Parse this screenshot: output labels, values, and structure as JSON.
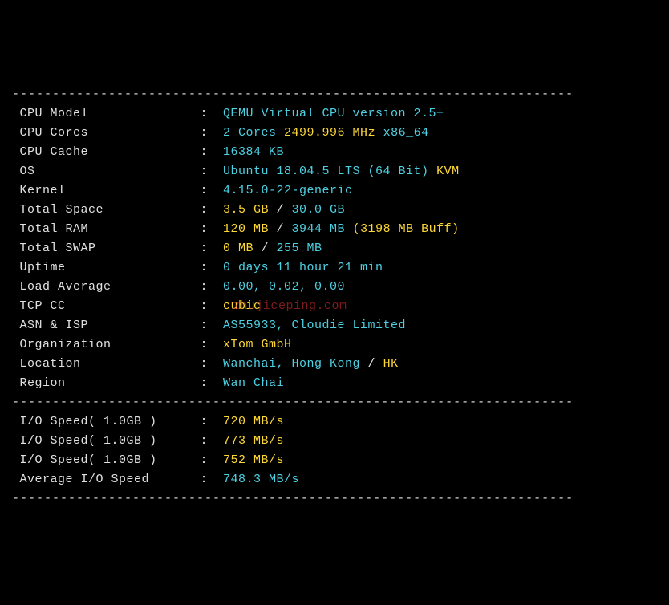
{
  "divider": "----------------------------------------------------------------------",
  "rows": [
    {
      "label": "CPU Model",
      "value": [
        {
          "c": "cyan",
          "t": "QEMU Virtual CPU version 2.5+"
        }
      ]
    },
    {
      "label": "CPU Cores",
      "value": [
        {
          "c": "cyan",
          "t": "2 Cores"
        },
        {
          "c": "white",
          "t": " "
        },
        {
          "c": "yellow",
          "t": "2499.996 MHz"
        },
        {
          "c": "white",
          "t": " "
        },
        {
          "c": "cyan",
          "t": "x86_64"
        }
      ]
    },
    {
      "label": "CPU Cache",
      "value": [
        {
          "c": "cyan",
          "t": "16384 KB"
        }
      ]
    },
    {
      "label": "OS",
      "value": [
        {
          "c": "cyan",
          "t": "Ubuntu 18.04.5 LTS (64 Bit)"
        },
        {
          "c": "white",
          "t": " "
        },
        {
          "c": "yellow",
          "t": "KVM"
        }
      ]
    },
    {
      "label": "Kernel",
      "value": [
        {
          "c": "cyan",
          "t": "4.15.0-22-generic"
        }
      ]
    },
    {
      "label": "Total Space",
      "value": [
        {
          "c": "yellow",
          "t": "3.5 GB"
        },
        {
          "c": "white",
          "t": " / "
        },
        {
          "c": "cyan",
          "t": "30.0 GB"
        }
      ]
    },
    {
      "label": "Total RAM",
      "value": [
        {
          "c": "yellow",
          "t": "120 MB"
        },
        {
          "c": "white",
          "t": " / "
        },
        {
          "c": "cyan",
          "t": "3944 MB"
        },
        {
          "c": "white",
          "t": " "
        },
        {
          "c": "yellow",
          "t": "(3198 MB Buff)"
        }
      ]
    },
    {
      "label": "Total SWAP",
      "value": [
        {
          "c": "yellow",
          "t": "0 MB"
        },
        {
          "c": "white",
          "t": " / "
        },
        {
          "c": "cyan",
          "t": "255 MB"
        }
      ]
    },
    {
      "label": "Uptime",
      "value": [
        {
          "c": "cyan",
          "t": "0 days 11 hour 21 min"
        }
      ]
    },
    {
      "label": "Load Average",
      "value": [
        {
          "c": "cyan",
          "t": "0.00, 0.02, 0.00"
        }
      ]
    },
    {
      "label": "TCP CC",
      "value": [
        {
          "c": "yellow",
          "t": "cubic"
        }
      ]
    },
    {
      "label": "ASN & ISP",
      "value": [
        {
          "c": "cyan",
          "t": "AS55933, Cloudie Limited"
        }
      ]
    },
    {
      "label": "Organization",
      "value": [
        {
          "c": "yellow",
          "t": "xTom GmbH"
        }
      ]
    },
    {
      "label": "Location",
      "value": [
        {
          "c": "cyan",
          "t": "Wanchai, Hong Kong"
        },
        {
          "c": "white",
          "t": " / "
        },
        {
          "c": "yellow",
          "t": "HK"
        }
      ]
    },
    {
      "label": "Region",
      "value": [
        {
          "c": "cyan",
          "t": "Wan Chai"
        }
      ]
    }
  ],
  "io_rows": [
    {
      "label": "I/O Speed( 1.0GB )",
      "value": [
        {
          "c": "yellow",
          "t": "720 MB/s"
        }
      ]
    },
    {
      "label": "I/O Speed( 1.0GB )",
      "value": [
        {
          "c": "yellow",
          "t": "773 MB/s"
        }
      ]
    },
    {
      "label": "I/O Speed( 1.0GB )",
      "value": [
        {
          "c": "yellow",
          "t": "752 MB/s"
        }
      ]
    },
    {
      "label": "Average I/O Speed",
      "value": [
        {
          "c": "cyan",
          "t": "748.3 MB/s"
        }
      ]
    }
  ],
  "watermark": "zhujiceping.com"
}
